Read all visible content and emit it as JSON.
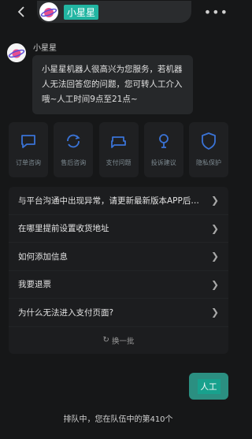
{
  "header": {
    "title": "小星星",
    "more_label": "•••"
  },
  "message": {
    "sender": "小星星",
    "text": "小星星机器人很高兴为您服务，若机器人无法回答您的问题，您可转人工介入哦~人工时间9点至21点~"
  },
  "shortcuts": [
    {
      "label": "订单咨询",
      "icon": "chat-icon"
    },
    {
      "label": "售后咨询",
      "icon": "refresh-chat-icon"
    },
    {
      "label": "支付问题",
      "icon": "wallet-icon"
    },
    {
      "label": "投诉建议",
      "icon": "lightbulb-icon"
    },
    {
      "label": "隐私保护",
      "icon": "shield-icon"
    }
  ],
  "faq": {
    "items": [
      "与平台沟通中出现异常，请更新最新版本APP后再试",
      "在哪里提前设置收货地址",
      "如何添加信息",
      "我要退票",
      "为什么无法进入支付页面?"
    ],
    "refresh_label": "换一批"
  },
  "human_button_label": "人工",
  "queue_text": "排队中，您在队伍中的第410个",
  "colors": {
    "accent": "#22b5a2",
    "background": "#161718",
    "bubble": "#26282a"
  }
}
